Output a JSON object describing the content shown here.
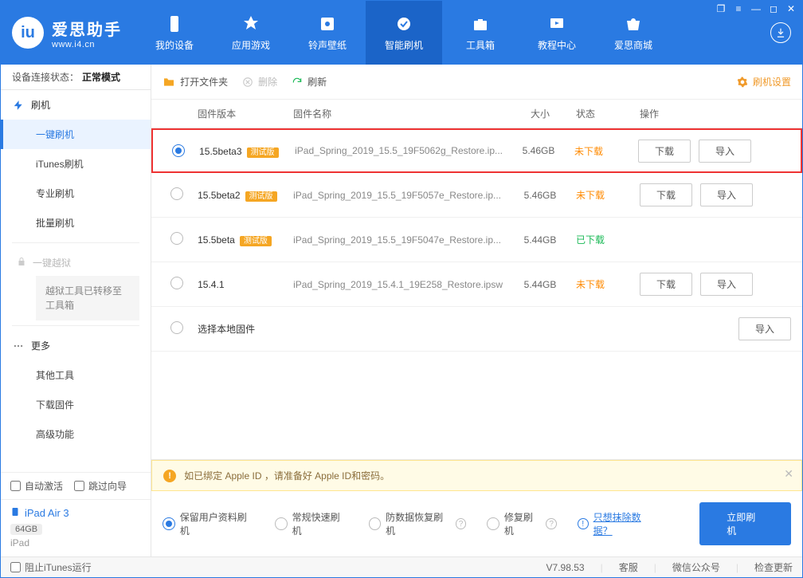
{
  "app": {
    "name": "爱思助手",
    "url": "www.i4.cn"
  },
  "window_controls": [
    "❐",
    "≡",
    "—",
    "◻",
    "✕"
  ],
  "nav": [
    {
      "id": "device",
      "label": "我的设备"
    },
    {
      "id": "apps",
      "label": "应用游戏"
    },
    {
      "id": "ring",
      "label": "铃声壁纸"
    },
    {
      "id": "flash",
      "label": "智能刷机",
      "active": true
    },
    {
      "id": "tools",
      "label": "工具箱"
    },
    {
      "id": "tutorial",
      "label": "教程中心"
    },
    {
      "id": "store",
      "label": "爱思商城"
    }
  ],
  "conn_status": {
    "prefix": "设备连接状态：",
    "value": "正常模式"
  },
  "sidebar": {
    "group_flash": {
      "label": "刷机"
    },
    "items_flash": [
      {
        "label": "一键刷机",
        "active": true
      },
      {
        "label": "iTunes刷机"
      },
      {
        "label": "专业刷机"
      },
      {
        "label": "批量刷机"
      }
    ],
    "jailbreak": {
      "label": "一键越狱",
      "note": "越狱工具已转移至工具箱"
    },
    "group_more": {
      "label": "更多"
    },
    "items_more": [
      {
        "label": "其他工具"
      },
      {
        "label": "下载固件"
      },
      {
        "label": "高级功能"
      }
    ],
    "checks": {
      "auto_activate": "自动激活",
      "skip_guide": "跳过向导"
    },
    "device": {
      "name": "iPad Air 3",
      "storage": "64GB",
      "type": "iPad"
    }
  },
  "toolbar": {
    "open_folder": "打开文件夹",
    "delete": "删除",
    "refresh": "刷新",
    "settings": "刷机设置"
  },
  "columns": {
    "version": "固件版本",
    "name": "固件名称",
    "size": "大小",
    "status": "状态",
    "ops": "操作"
  },
  "ops_labels": {
    "download": "下载",
    "import": "导入"
  },
  "status_labels": {
    "not_downloaded": "未下载",
    "downloaded": "已下载"
  },
  "beta_tag": "测试版",
  "rows": [
    {
      "selected": true,
      "version": "15.5beta3",
      "beta": true,
      "name": "iPad_Spring_2019_15.5_19F5062g_Restore.ip...",
      "size": "5.46GB",
      "status": "not_downloaded",
      "highlight": true
    },
    {
      "selected": false,
      "version": "15.5beta2",
      "beta": true,
      "name": "iPad_Spring_2019_15.5_19F5057e_Restore.ip...",
      "size": "5.46GB",
      "status": "not_downloaded"
    },
    {
      "selected": false,
      "version": "15.5beta",
      "beta": true,
      "name": "iPad_Spring_2019_15.5_19F5047e_Restore.ip...",
      "size": "5.44GB",
      "status": "downloaded"
    },
    {
      "selected": false,
      "version": "15.4.1",
      "beta": false,
      "name": "iPad_Spring_2019_15.4.1_19E258_Restore.ipsw",
      "size": "5.44GB",
      "status": "not_downloaded"
    }
  ],
  "local_row_label": "选择本地固件",
  "alert": "如已绑定 Apple ID ，请准备好 Apple ID和密码。",
  "options": [
    {
      "id": "keepdata",
      "label": "保留用户资料刷机",
      "selected": true
    },
    {
      "id": "normal",
      "label": "常规快速刷机"
    },
    {
      "id": "antidata",
      "label": "防数据恢复刷机",
      "help": true
    },
    {
      "id": "repair",
      "label": "修复刷机",
      "help": true
    }
  ],
  "erase_hint": {
    "icon": "!",
    "text": "只想抹除数据？"
  },
  "primary_btn": "立即刷机",
  "statusbar": {
    "block_itunes": "阻止iTunes运行",
    "version": "V7.98.53",
    "links": [
      "客服",
      "微信公众号",
      "检查更新"
    ]
  }
}
